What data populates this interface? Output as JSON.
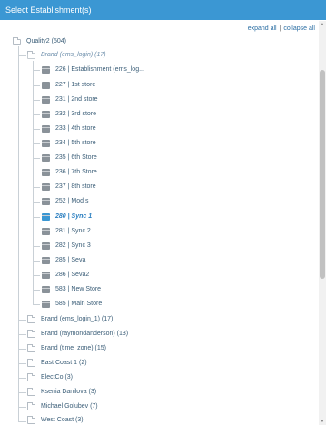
{
  "header": {
    "title": "Select Establishment(s)"
  },
  "actions": {
    "expand_all": "expand all",
    "separator": "|",
    "collapse_all": "collapse all"
  },
  "tree": {
    "root": {
      "label": "Quality2 (504)"
    },
    "open_brand": {
      "label": "Brand (ems_login) (17)",
      "stores": [
        {
          "label": "226 | Establishment (ems_log..."
        },
        {
          "label": "227 | 1st store"
        },
        {
          "label": "231 | 2nd store"
        },
        {
          "label": "232 | 3rd store"
        },
        {
          "label": "233 | 4th store"
        },
        {
          "label": "234 | 5th store"
        },
        {
          "label": "235 | 6th Store"
        },
        {
          "label": "236 | 7th Store"
        },
        {
          "label": "237 | 8th store"
        },
        {
          "label": "252 | Mod s"
        },
        {
          "label": "280 | Sync 1",
          "selected": true
        },
        {
          "label": "281 | Sync 2"
        },
        {
          "label": "282 | Sync 3"
        },
        {
          "label": "285 | Seva"
        },
        {
          "label": "286 | Seva2"
        },
        {
          "label": "583 | New Store"
        },
        {
          "label": "585 | Main Store"
        }
      ]
    },
    "groups": [
      {
        "label": "Brand (ems_login_1) (17)"
      },
      {
        "label": "Brand (raymondanderson) (13)"
      },
      {
        "label": "Brand (time_zone) (15)"
      },
      {
        "label": "East Coast 1 (2)"
      },
      {
        "label": "ElectCo (3)"
      },
      {
        "label": "Ksenia Danilova (3)"
      },
      {
        "label": "Michael Golubev (7)"
      },
      {
        "label": "West Coast (3)"
      }
    ]
  },
  "colors": {
    "header_bg": "#3b97d3",
    "link": "#2b6ea3",
    "selected": "#2b7fc0"
  }
}
